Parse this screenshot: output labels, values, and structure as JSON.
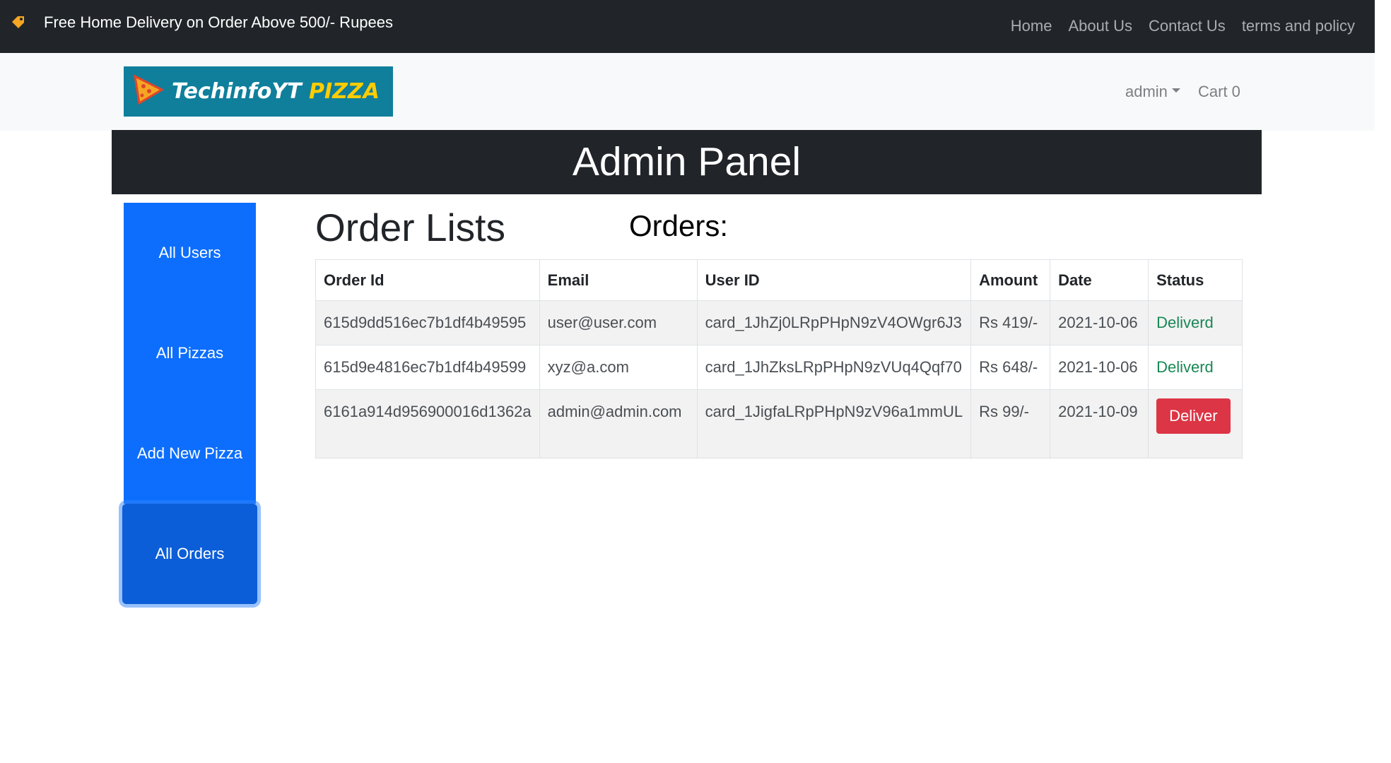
{
  "topbar": {
    "promo": "Free Home Delivery on Order Above 500/- Rupees",
    "nav": [
      "Home",
      "About Us",
      "Contact Us",
      "terms and policy"
    ]
  },
  "navbar": {
    "logo": {
      "part1": "TechinfoYT ",
      "part2": "PIZZA"
    },
    "user_menu": "admin",
    "cart": "Cart 0"
  },
  "header": {
    "title": "Admin Panel"
  },
  "sidebar": {
    "items": [
      {
        "label": "All Users"
      },
      {
        "label": "All Pizzas"
      },
      {
        "label": "Add New Pizza"
      },
      {
        "label": "All Orders"
      }
    ]
  },
  "main": {
    "section_title": "Order Lists",
    "orders_label": "Orders:",
    "table": {
      "headers": [
        "Order Id",
        "Email",
        "User ID",
        "Amount",
        "Date",
        "Status"
      ],
      "rows": [
        {
          "order_id": "615d9dd516ec7b1df4b49595",
          "email": "user@user.com",
          "user_id": "card_1JhZj0LRpPHpN9zV4OWgr6J3",
          "amount": "Rs 419/-",
          "date": "2021-10-06",
          "status": "Deliverd"
        },
        {
          "order_id": "615d9e4816ec7b1df4b49599",
          "email": "xyz@a.com",
          "user_id": "card_1JhZksLRpPHpN9zVUq4Qqf70",
          "amount": "Rs 648/-",
          "date": "2021-10-06",
          "status": "Deliverd"
        },
        {
          "order_id": "6161a914d956900016d1362a",
          "email": "admin@admin.com",
          "user_id": "card_1JigfaLRpPHpN9zV96a1mmUL",
          "amount": "Rs 99/-",
          "date": "2021-10-09",
          "action": "Deliver"
        }
      ]
    }
  },
  "colors": {
    "primary": "#0d6efd",
    "danger": "#dc3545",
    "success": "#198754",
    "dark": "#212529"
  }
}
